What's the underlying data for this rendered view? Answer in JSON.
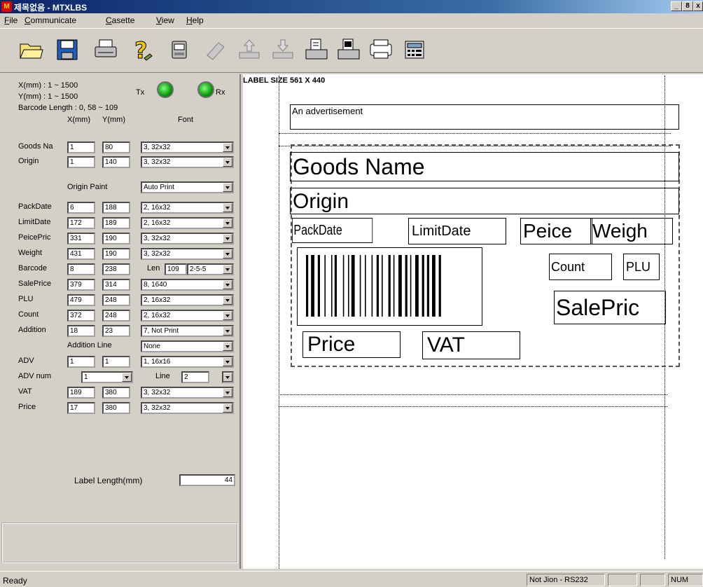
{
  "window": {
    "app_icon_label": "M",
    "title": "제목없음 - MTXLBS",
    "min_label": "_",
    "max_label": "8",
    "close_label": "x"
  },
  "menu": [
    "File",
    "Communicate",
    "Casette",
    "View",
    "Help"
  ],
  "toolbar": [
    {
      "icon": "open-folder-icon"
    },
    {
      "icon": "save-disk-icon"
    },
    {
      "icon": "print-icon"
    },
    {
      "icon": "help-question-icon"
    },
    {
      "icon": "label-printer-icon"
    },
    {
      "icon": "eraser-icon"
    },
    {
      "icon": "upload-tray-icon"
    },
    {
      "icon": "download-tray-icon"
    },
    {
      "icon": "send-document-icon"
    },
    {
      "icon": "receive-document-icon"
    },
    {
      "icon": "printer-icon"
    },
    {
      "icon": "calculator-icon"
    }
  ],
  "panel": {
    "x_range": "X(mm) : 1 ~ 1500",
    "y_range": "Y(mm) : 1 ~ 1500",
    "barcode_length": "Barcode Length : 0, 58 ~ 109",
    "tx_label": "Tx",
    "rx_label": "Rx",
    "col_x": "X(mm)",
    "col_y": "Y(mm)",
    "col_font": "Font",
    "rows": {
      "goods_name": {
        "label": "Goods Na",
        "x": "1",
        "y": "80",
        "font": "3, 32x32"
      },
      "origin": {
        "label": "Origin",
        "x": "1",
        "y": "140",
        "font": "3, 32x32"
      },
      "packdate": {
        "label": "PackDate",
        "x": "6",
        "y": "188",
        "font": "2, 16x32"
      },
      "limitdate": {
        "label": "LimitDate",
        "x": "172",
        "y": "189",
        "font": "2, 16x32"
      },
      "peiceprice": {
        "label": "PeicePric",
        "x": "331",
        "y": "190",
        "font": "3, 32x32"
      },
      "weight": {
        "label": "Weight",
        "x": "431",
        "y": "190",
        "font": "3, 32x32"
      },
      "barcode": {
        "label": "Barcode",
        "x": "8",
        "y": "238"
      },
      "saleprice": {
        "label": "SalePrice",
        "x": "379",
        "y": "314",
        "font": "8, 1640"
      },
      "plu": {
        "label": "PLU",
        "x": "479",
        "y": "248",
        "font": "2, 16x32"
      },
      "count": {
        "label": "Count",
        "x": "372",
        "y": "248",
        "font": "2, 16x32"
      },
      "addition": {
        "label": "Addition",
        "x": "18",
        "y": "23",
        "font": "7, Not Print"
      },
      "adv": {
        "label": "ADV",
        "x": "1",
        "y": "1",
        "font": "1, 16x16"
      },
      "vat": {
        "label": "VAT",
        "x": "189",
        "y": "380",
        "font": "3, 32x32"
      },
      "price": {
        "label": "Price",
        "x": "17",
        "y": "380",
        "font": "3, 32x32"
      }
    },
    "origin_paint_label": "Origin Paint",
    "origin_paint_value": "Auto Print",
    "barcode_len_label": "Len",
    "barcode_len_value": "109",
    "barcode_type": "2-5-5",
    "addition_line_label": "Addition Line",
    "addition_line_value": "None",
    "adv_num_label": "ADV num",
    "adv_num_value": "1",
    "line_label": "Line",
    "line_value": "2",
    "label_length_label": "Label Length(mm)",
    "label_length_value": "44"
  },
  "canvas": {
    "label_size": "LABEL SIZE 561 X 440",
    "advertisement": "An advertisement",
    "goods_name": "Goods Name",
    "origin": "Origin",
    "packdate": "PackDate",
    "limitdate": "LimitDate",
    "peice": "Peice",
    "weigh": "Weigh",
    "count": "Count",
    "plu": "PLU",
    "saleprice": "SalePric",
    "price": "Price",
    "vat": "VAT"
  },
  "status": {
    "ready": "Ready",
    "connection": "Not Jion - RS232",
    "num": "NUM"
  }
}
